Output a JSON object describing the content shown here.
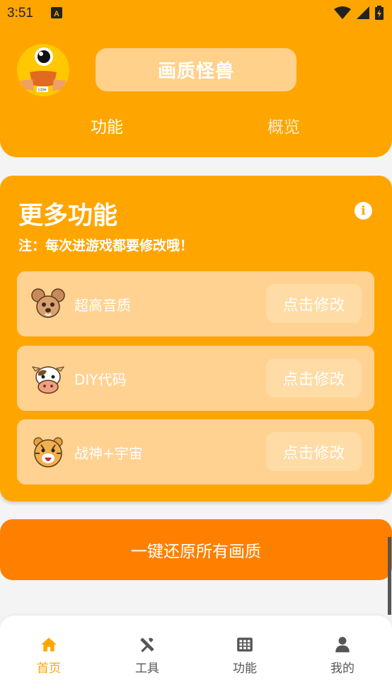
{
  "status_bar": {
    "time": "3:51",
    "notification_icon": "a-notification-icon",
    "wifi_icon": "wifi-icon",
    "signal_icon": "signal-icon",
    "battery_icon": "battery-charging-icon"
  },
  "header": {
    "avatar_icon": "monster-avatar-icon",
    "title": "画质怪兽",
    "tabs": [
      {
        "label": "功能"
      },
      {
        "label": "概览"
      }
    ]
  },
  "more_features": {
    "title": "更多功能",
    "note": "注：每次进游戏都要修改哦！",
    "info_icon": "info-icon",
    "items": [
      {
        "label": "超高音质",
        "button": "点击修改",
        "icon": "mouse-face-icon"
      },
      {
        "label": "DIY代码",
        "button": "点击修改",
        "icon": "cow-face-icon"
      },
      {
        "label": "战神+宇宙",
        "button": "点击修改",
        "icon": "tiger-face-icon"
      }
    ]
  },
  "restore_button": "一键还原所有画质",
  "bottom_nav": {
    "items": [
      {
        "label": "首页",
        "icon": "home-icon",
        "active": true
      },
      {
        "label": "工具",
        "icon": "tools-icon",
        "active": false
      },
      {
        "label": "功能",
        "icon": "grid-icon",
        "active": false
      },
      {
        "label": "我的",
        "icon": "person-icon",
        "active": false
      }
    ]
  },
  "colors": {
    "primary": "#ffa500",
    "accent": "#ff8000",
    "row_bg": "#ffd291",
    "page_bg": "#f4f4f4"
  }
}
